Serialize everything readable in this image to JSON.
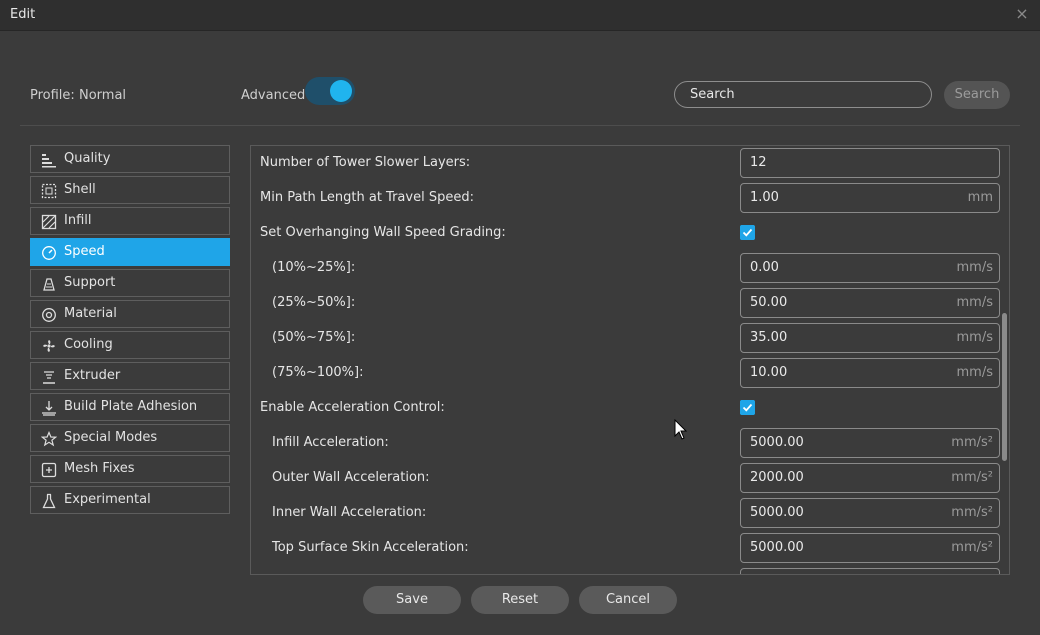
{
  "window": {
    "title": "Edit",
    "close_glyph": "×"
  },
  "header": {
    "profile_label": "Profile:",
    "profile_value": "Normal",
    "advanced_label": "Advanced",
    "advanced_enabled": true,
    "search_placeholder": "Search",
    "search_button": "Search"
  },
  "sidebar": {
    "items": [
      {
        "label": "Quality",
        "icon": "quality-icon"
      },
      {
        "label": "Shell",
        "icon": "shell-icon"
      },
      {
        "label": "Infill",
        "icon": "infill-icon"
      },
      {
        "label": "Speed",
        "icon": "speed-icon",
        "active": true
      },
      {
        "label": "Support",
        "icon": "support-icon"
      },
      {
        "label": "Material",
        "icon": "material-icon"
      },
      {
        "label": "Cooling",
        "icon": "cooling-fan-icon"
      },
      {
        "label": "Extruder",
        "icon": "extruder-icon"
      },
      {
        "label": "Build Plate Adhesion",
        "icon": "build-plate-icon"
      },
      {
        "label": "Special Modes",
        "icon": "star-icon"
      },
      {
        "label": "Mesh Fixes",
        "icon": "mesh-fix-icon"
      },
      {
        "label": "Experimental",
        "icon": "flask-icon"
      }
    ]
  },
  "settings": {
    "rows": [
      {
        "label": "Number of Tower Slower Layers:",
        "value": "12",
        "unit": ""
      },
      {
        "label": "Min Path Length at Travel Speed:",
        "value": "1.00",
        "unit": "mm"
      },
      {
        "label": "Set Overhanging Wall Speed Grading:",
        "checked": true
      },
      {
        "label": "(10%~25%]:",
        "value": "0.00",
        "unit": "mm/s",
        "indent": true
      },
      {
        "label": "(25%~50%]:",
        "value": "50.00",
        "unit": "mm/s",
        "indent": true
      },
      {
        "label": "(50%~75%]:",
        "value": "35.00",
        "unit": "mm/s",
        "indent": true
      },
      {
        "label": "(75%~100%]:",
        "value": "10.00",
        "unit": "mm/s",
        "indent": true
      },
      {
        "label": "Enable Acceleration Control:",
        "checked": true
      },
      {
        "label": "Infill Acceleration:",
        "value": "5000.00",
        "unit": "mm/s²",
        "indent": true
      },
      {
        "label": "Outer Wall Acceleration:",
        "value": "2000.00",
        "unit": "mm/s²",
        "indent": true
      },
      {
        "label": "Inner Wall Acceleration:",
        "value": "5000.00",
        "unit": "mm/s²",
        "indent": true
      },
      {
        "label": "Top Surface Skin Acceleration:",
        "value": "5000.00",
        "unit": "mm/s²",
        "indent": true
      },
      {
        "label": "",
        "value": "",
        "unit": "",
        "indent": true
      }
    ]
  },
  "footer": {
    "save": "Save",
    "reset": "Reset",
    "cancel": "Cancel"
  },
  "colors": {
    "accent": "#1fa5e8",
    "background": "#3b3b3b",
    "titlebar": "#2f2f2f"
  }
}
